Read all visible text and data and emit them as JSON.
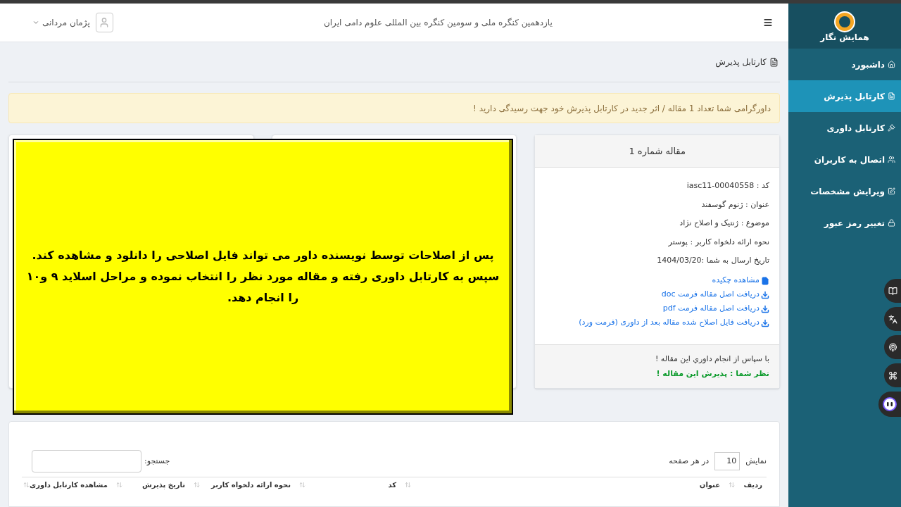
{
  "header": {
    "title": "یازدهمین کنگره ملی و سومین کنگره بین المللی علوم دامی ایران",
    "user": "پژمان مردانی"
  },
  "sidebar": {
    "logo_text": "همایش نگار",
    "items": [
      {
        "label": "داشبورد",
        "selected": false
      },
      {
        "label": "کارتابل پذیرش",
        "selected": true
      },
      {
        "label": "کارتابل داوری",
        "selected": false
      },
      {
        "label": "اتصال به کاربران",
        "selected": false
      },
      {
        "label": "ویرایش مشخصات",
        "selected": false
      },
      {
        "label": "تغییر رمز عبور",
        "selected": false
      }
    ]
  },
  "page_title": "کارتابل پذیرش",
  "alert": "داورگرامی شما تعداد 1 مقاله / اثر جدید در کارتابل پذیرش خود جهت رسیدگی دارید !",
  "article_card": {
    "title": "مقاله شماره 1",
    "fields": [
      "کد : iasc11-00040558",
      "عنوان : ژنوم گوسفند",
      "موضوع : ژنتیک و اصلاح نژاد",
      "نحوه ارائه دلخواه کاربر : پوستر",
      "تاریخ ارسال به شما :1404/03/20"
    ],
    "links": [
      {
        "kind": "view",
        "label": "مشاهده چکیده"
      },
      {
        "kind": "download",
        "label": "دریافت اصل مقاله فرمت doc"
      },
      {
        "kind": "download",
        "label": "دریافت اصل مقاله فرمت pdf"
      },
      {
        "kind": "download",
        "label": "دریافت فایل اصلاح شده مقاله بعد از داوری (فرمت ورد)"
      }
    ],
    "footer": {
      "message": "با سپاس از انجام داوري اين مقاله !",
      "verdict": "نظر شما : پذیرش این مقاله !"
    }
  },
  "callout": "پس از اصلاحات توسط نویسنده  داور می تواند فایل اصلاحی را دانلود و مشاهده کند. سپس به کارتابل داوری رفته و مقاله مورد نظر را انتخاب نموده و مراحل اسلاید ۹ و۱۰ را انجام دهد.",
  "table": {
    "show_label": "نمایش",
    "page_length": "10",
    "per_page_label": "در هر صفحه",
    "search_label": "جستجو:",
    "columns": [
      "ردیف",
      "عنوان",
      "کد",
      "نحوه ارائه دلخواه کاربر",
      "تاریخ پذیرش",
      "مشاهده کارتابل داوری"
    ]
  }
}
